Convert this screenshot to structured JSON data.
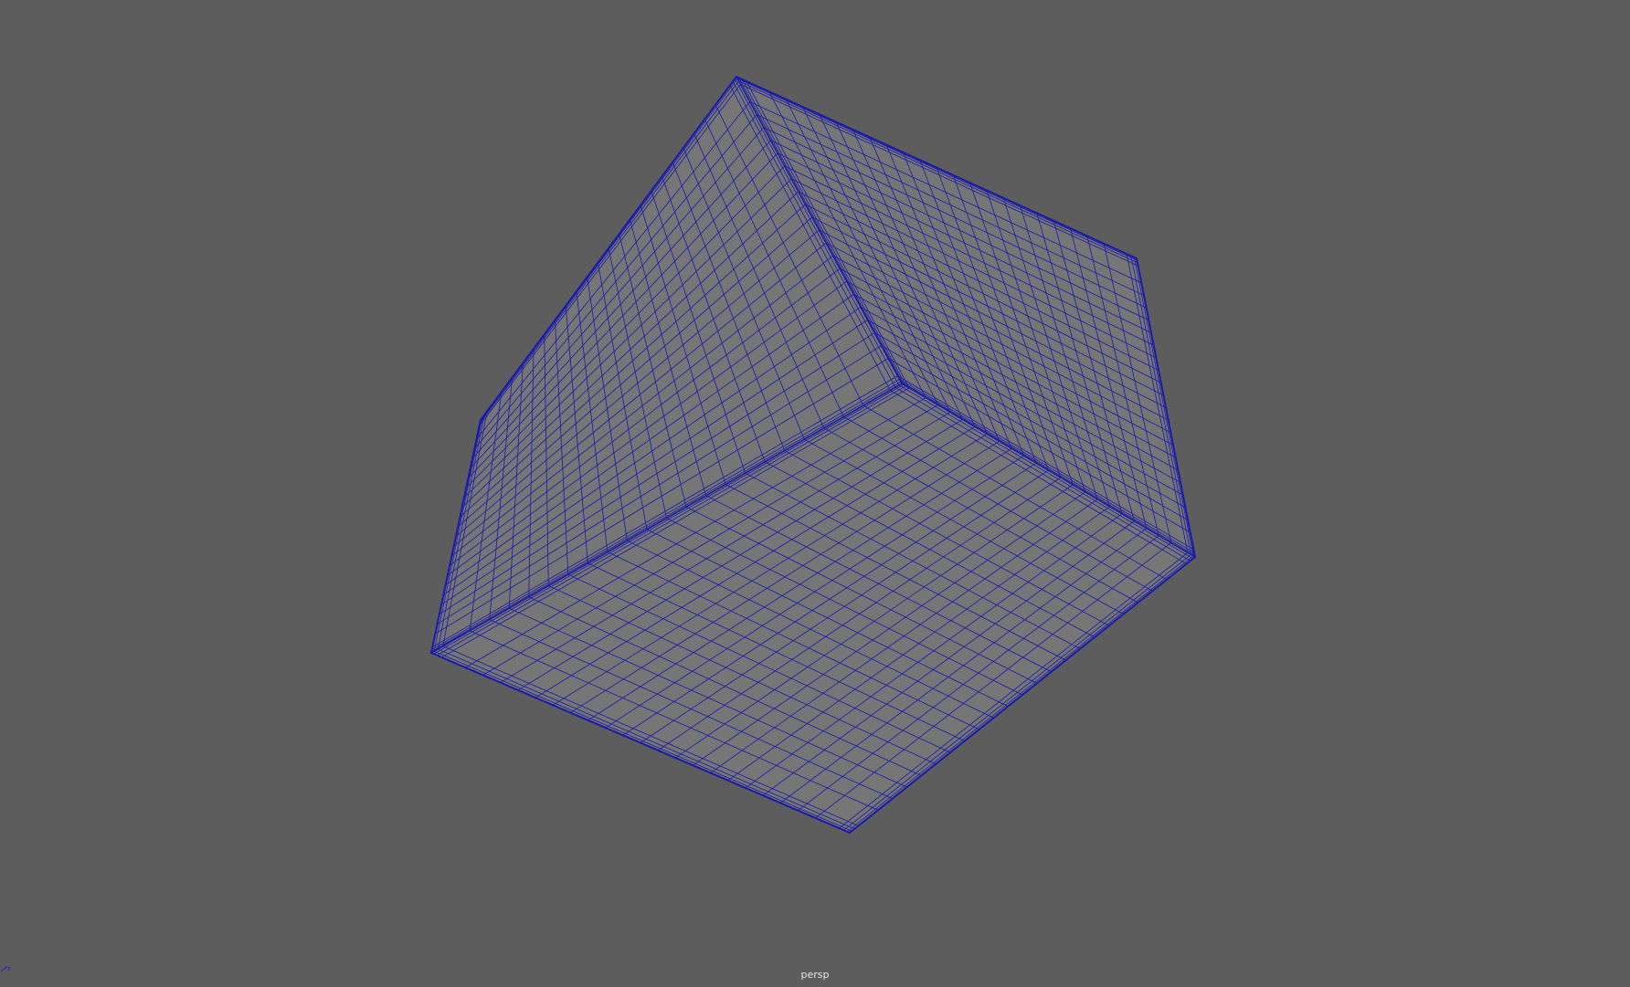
{
  "viewport": {
    "camera_label": "persp",
    "background_color": "#5d5d5d"
  },
  "mesh": {
    "shape": "rounded cube",
    "wireframe_color": "#1a1aa8",
    "fill_color": "#767676",
    "face_divisions": 22
  },
  "axis_indicator": {
    "color": "#1f1fd0",
    "label": "z"
  }
}
